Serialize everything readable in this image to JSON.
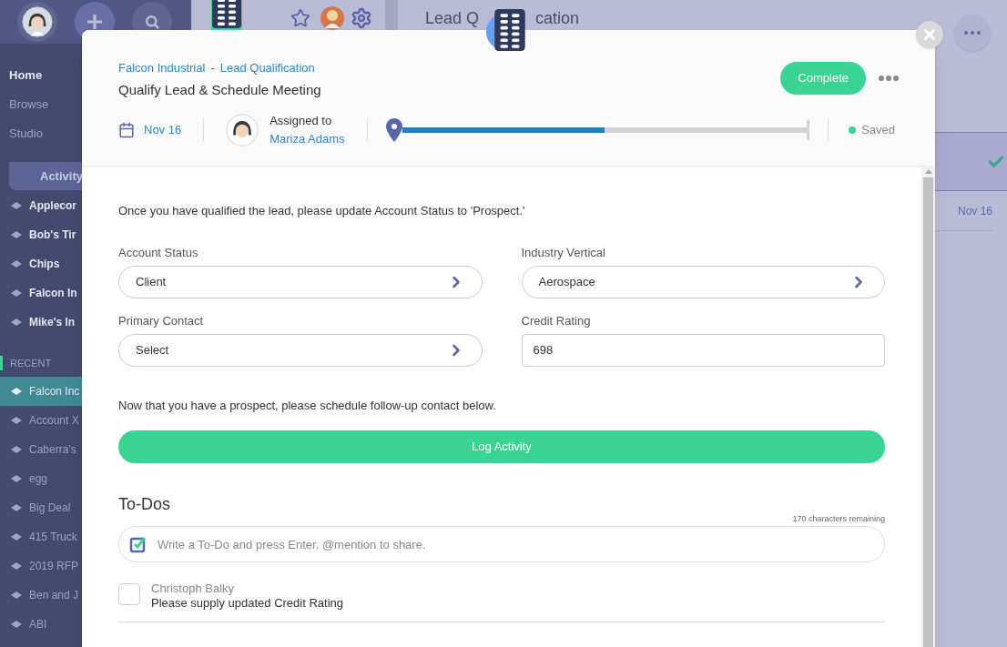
{
  "sidebar": {
    "nav": [
      {
        "label": "Home",
        "selected": true
      },
      {
        "label": "Browse",
        "selected": false
      },
      {
        "label": "Studio",
        "selected": false
      }
    ],
    "tab": "Activity",
    "items": [
      "Applecor",
      "Bob's Tir",
      "Chips",
      "Falcon In",
      "Mike's In"
    ],
    "recent_heading": "RECENT",
    "recent": [
      {
        "label": "Falcon Inc",
        "selected": true
      },
      {
        "label": "Account X",
        "selected": false
      },
      {
        "label": "Caberra's",
        "selected": false
      },
      {
        "label": "egg",
        "selected": false
      },
      {
        "label": "Big Deal",
        "selected": false
      },
      {
        "label": "415 Truck",
        "selected": false
      },
      {
        "label": "2019 RFP",
        "selected": false
      },
      {
        "label": "Ben and J",
        "selected": false
      },
      {
        "label": "ABI",
        "selected": false
      }
    ]
  },
  "page": {
    "title_parts": [
      "Lead Q",
      "cation"
    ],
    "row_date": "Nov 16"
  },
  "modal": {
    "breadcrumb": [
      "Falcon Industrial",
      "Lead Qualification"
    ],
    "separator": "-",
    "title": "Qualify Lead & Schedule Meeting",
    "complete": "Complete",
    "date": "Nov 16",
    "assigned_label": "Assigned to",
    "assignee": "Mariza Adams",
    "progress": {
      "level": 0.5
    },
    "status": "Saved",
    "instruction": "Once you have qualified the lead, please update Account Status to 'Prospect.'",
    "fields": [
      {
        "label": "Account Status",
        "kind": "select",
        "value": "Client"
      },
      {
        "label": "Industry Vertical",
        "kind": "select",
        "value": "Aerospace"
      },
      {
        "label": "Primary Contact",
        "kind": "select",
        "value": "Select"
      },
      {
        "label": "Credit Rating",
        "kind": "text",
        "value": "698"
      }
    ],
    "followup": "Now that you have a prospect, please schedule follow-up contact below.",
    "log_button": "Log Activity",
    "todos": {
      "heading": "To-Dos",
      "remaining": "170 characters remaining",
      "placeholder": "Write a To-Do and press Enter. @mention to share.",
      "items": [
        {
          "author": "Christoph Balky",
          "text": "Please supply updated Credit Rating",
          "checked": false
        }
      ]
    }
  }
}
